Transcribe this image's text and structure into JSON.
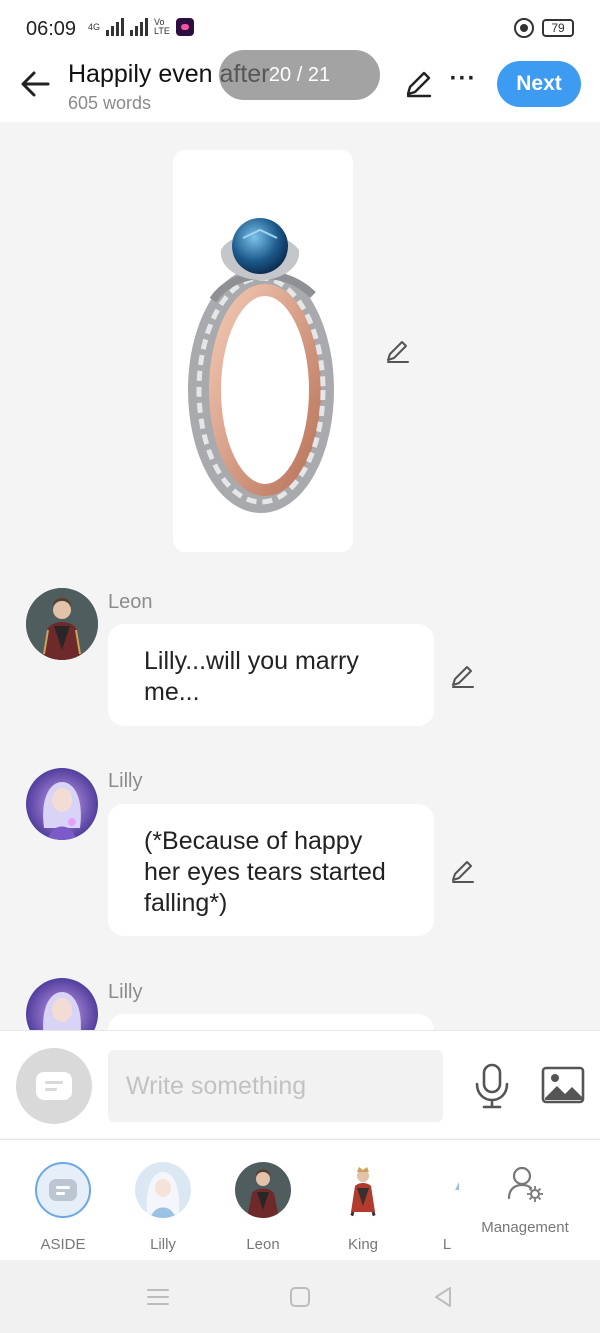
{
  "status_bar": {
    "time": "06:09",
    "network_tag": "4G",
    "volte_tag_top": "Vo",
    "volte_tag_bottom": "LTE",
    "battery": "79"
  },
  "header": {
    "title": "Happily even after",
    "word_count": "605 words",
    "page_indicator": "20 / 21",
    "next_label": "Next"
  },
  "messages": [
    {
      "speaker": "Leon",
      "text": "Lilly...will you marry me..."
    },
    {
      "speaker": "Lilly",
      "text": "(*Because of happy her eyes tears started falling*)"
    },
    {
      "speaker": "Lilly",
      "text": ""
    }
  ],
  "input": {
    "placeholder": "Write something"
  },
  "characters": [
    {
      "label": "ASIDE"
    },
    {
      "label": "Lilly"
    },
    {
      "label": "Leon"
    },
    {
      "label": "King"
    },
    {
      "label": "L"
    }
  ],
  "management_label": "Management",
  "colors": {
    "accent": "#3d9bf2",
    "background": "#f4f4f5",
    "bubble": "#ffffff",
    "speaker_name": "#8c8c8c"
  },
  "icons": [
    "back-arrow-icon",
    "pen-icon",
    "more-icon",
    "mic-icon",
    "image-icon",
    "chat-bubble-icon",
    "management-icon"
  ]
}
